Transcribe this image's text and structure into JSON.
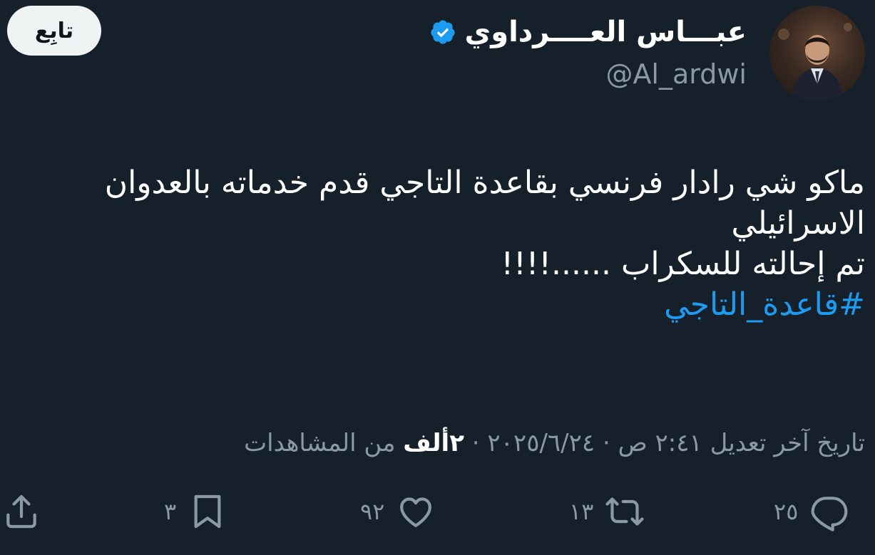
{
  "author": {
    "name": "عبـــاس العــــرداوي",
    "handle": "@Al_ardwi",
    "verified": true,
    "verified_color": "#1d9bf0"
  },
  "follow_button": {
    "label": "تابِع"
  },
  "tweet": {
    "lines": [
      "ماكو شي رادار فرنسي بقاعدة التاجي قدم خدماته بالعدوان",
      "الاسرائيلي",
      "تم إحالته للسكراب ......!!!!"
    ],
    "hashtag": "#قاعدة_التاجي",
    "hashtag_color": "#1d9bf0"
  },
  "meta": {
    "edited_label": "تاريخ آخر تعديل",
    "time": "٢:٤١ ص",
    "separator": "·",
    "date": "٢٠٢٥/٦/٢٤",
    "views_count": "٢ألف",
    "views_label": "من المشاهدات"
  },
  "actions": {
    "replies": "٢٥",
    "retweets": "١٣",
    "likes": "٩٢",
    "bookmarks": "٣"
  },
  "colors": {
    "background": "#15202b",
    "text": "#ffffff",
    "muted": "#8b98a5",
    "accent": "#1d9bf0"
  }
}
